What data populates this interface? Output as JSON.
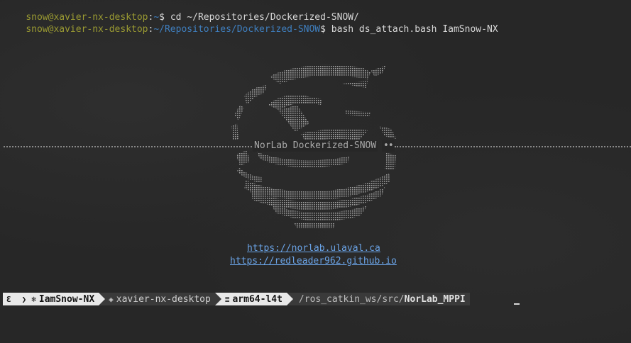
{
  "terminal": {
    "line1": {
      "user_host": "snow@xavier-nx-desktop",
      "colon": ":",
      "path": "~",
      "prompt": "$ ",
      "command": "cd ~/Repositories/Dockerized-SNOW/"
    },
    "line2": {
      "user_host": "snow@xavier-nx-desktop",
      "colon": ":",
      "path": "~/Repositories/Dockerized-SNOW",
      "prompt": "$ ",
      "command": "bash ds_attach.bash IamSnow-NX"
    }
  },
  "banner": {
    "title": "NorLab Dockerized-SNOW",
    "title_dots": "••",
    "links": [
      "https://norlab.ulaval.ca",
      "https://redleader962.github.io"
    ]
  },
  "statusbar": {
    "segments": [
      {
        "icon": "snow-logo-icon",
        "glyph": "Ɛ",
        "text": ""
      },
      {
        "icon": "chevron-right-icon",
        "glyph": "❯",
        "text": ""
      },
      {
        "icon": "container-icon",
        "glyph": "❄",
        "text": "IamSnow-NX"
      },
      {
        "icon": "host-icon",
        "glyph": "◈",
        "text": "xavier-nx-desktop"
      },
      {
        "icon": "arch-icon",
        "glyph": "≣",
        "text": "arm64-l4t"
      }
    ],
    "path_prefix": "/ros_catkin_ws/src/",
    "path_current": "NorLab_MPPI"
  },
  "colors": {
    "background": "#272727",
    "user_host": "#9a9a32",
    "path": "#3f7fbf",
    "link": "#6aa3e6",
    "segment_light": "#e8e8e8",
    "segment_dark": "#3a3a3a"
  }
}
